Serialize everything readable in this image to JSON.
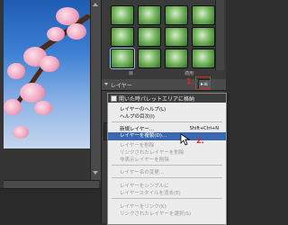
{
  "canvas": {
    "photo": "cherry blossom photo"
  },
  "effects_panel": {
    "labels": [
      "目",
      "適用"
    ]
  },
  "layers_panel": {
    "title": "レイヤー",
    "menu_button_icon": "panel-menu-icon",
    "annotation_1": "1.",
    "annotation_2": "2."
  },
  "panel_menu": {
    "header_check_label": "開いた時パレットエリアに格納",
    "items": [
      {
        "label": "レイヤーのヘルプ(L)",
        "disabled": false
      },
      {
        "label": "ヘルプの目次(I)",
        "disabled": false
      },
      {
        "label": "新規レイヤー...",
        "shortcut": "Shift+Ctrl+N",
        "disabled": false
      },
      {
        "label": "レイヤーを複製(D)...",
        "disabled": false,
        "highlighted": true
      },
      {
        "label": "レイヤーを削除",
        "disabled": true
      },
      {
        "label": "リンクされたレイヤーを削除",
        "disabled": true
      },
      {
        "label": "非表示レイヤーを削除",
        "disabled": true
      },
      {
        "label": "レイヤー名の変更...",
        "disabled": true
      },
      {
        "label": "レイヤーをシンプルに",
        "disabled": true
      },
      {
        "label": "レイヤースタイルを消去(E)",
        "disabled": true
      },
      {
        "label": "レイヤーをリンク(K)",
        "disabled": true
      },
      {
        "label": "リンクされたレイヤーを選択(S)",
        "disabled": true
      }
    ]
  },
  "colors": {
    "accent_red": "#e0281e",
    "highlight_blue": "#3b67b0",
    "panel_bg": "#3a3a3a"
  }
}
